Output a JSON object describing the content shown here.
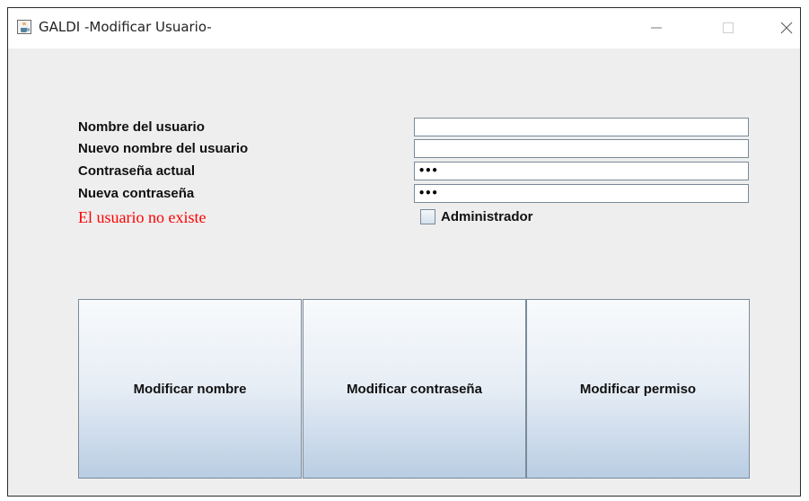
{
  "window": {
    "title": "GALDI -Modificar Usuario-",
    "app_icon": "java-cup-icon"
  },
  "form": {
    "labels": {
      "username": "Nombre del usuario",
      "new_username": "Nuevo nombre del usuario",
      "current_password": "Contraseña actual",
      "new_password": "Nueva contraseña"
    },
    "fields": {
      "username_value": "",
      "new_username_value": "",
      "current_password_value": "•••",
      "new_password_value": "•••"
    },
    "error_message": "El usuario no existe",
    "error_color": "#ff0000",
    "admin_checkbox": {
      "label": "Administrador",
      "checked": false
    }
  },
  "buttons": {
    "modify_name": "Modificar nombre",
    "modify_password": "Modificar contraseña",
    "modify_permission": "Modificar permiso"
  }
}
